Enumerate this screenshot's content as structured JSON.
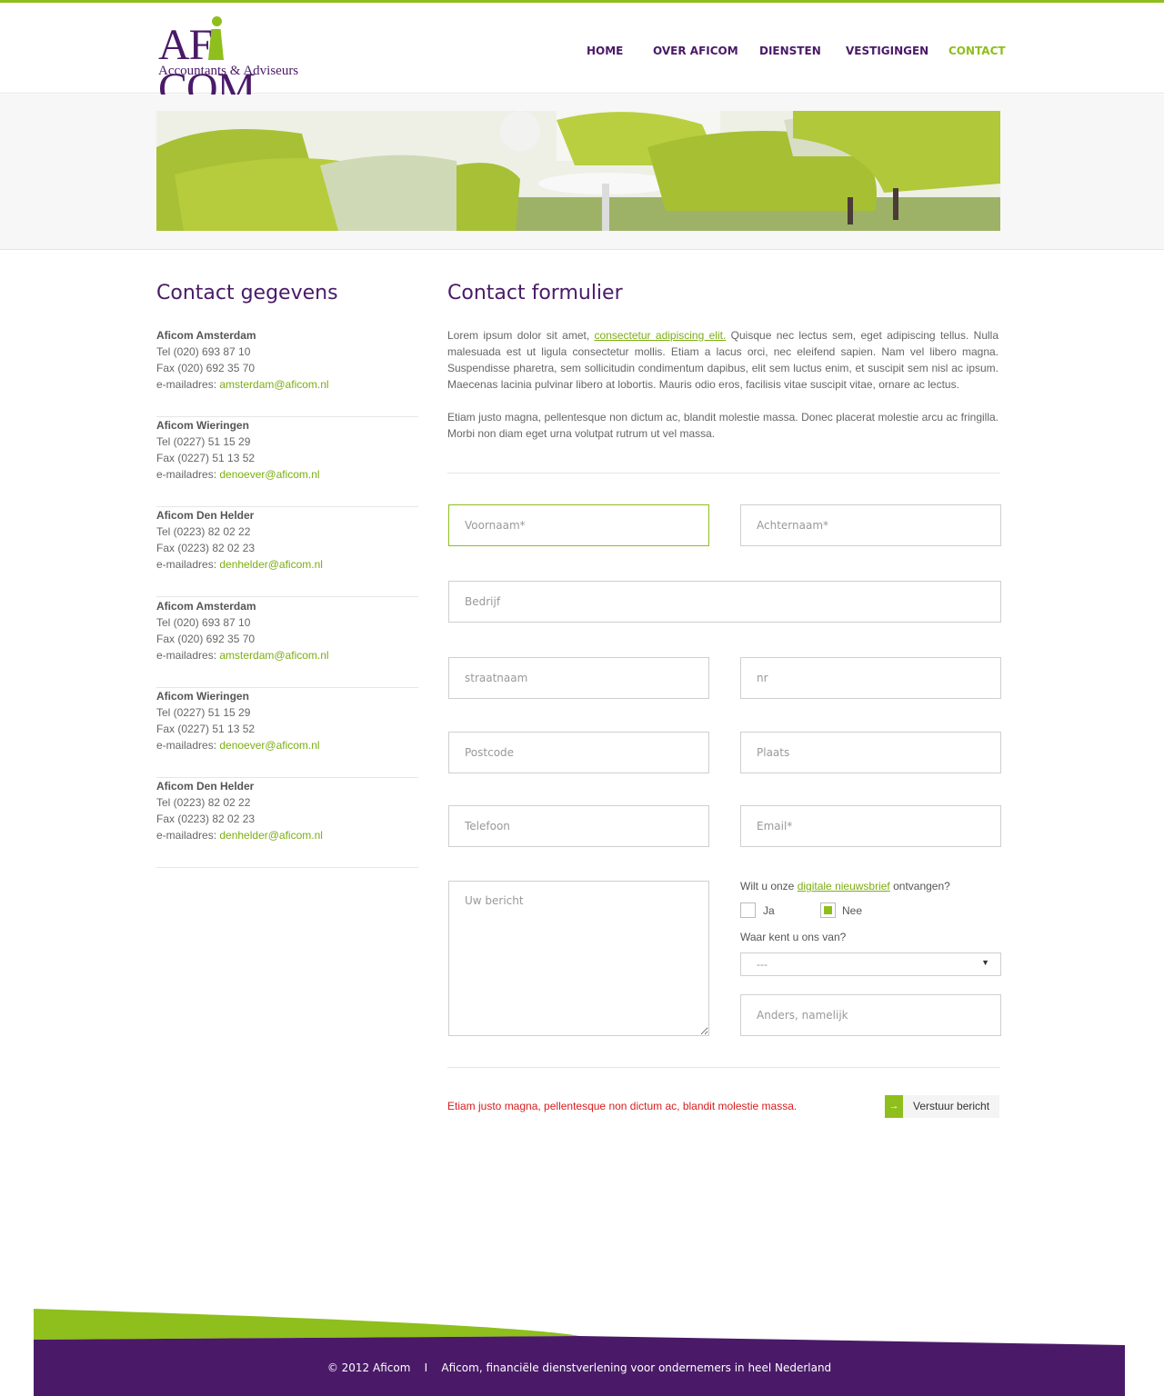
{
  "brand": {
    "logo_text": "AFICOM",
    "logo_tagline": "Accountants & Adviseurs",
    "primary_color": "#4a1a68",
    "accent_color": "#8ebf1c"
  },
  "nav": {
    "items": [
      "HOME",
      "OVER AFICOM",
      "DIENSTEN",
      "VESTIGINGEN",
      "CONTACT"
    ],
    "active": "CONTACT"
  },
  "sidebar": {
    "title": "Contact gegevens",
    "offices": [
      {
        "name": "Aficom Amsterdam",
        "tel": "Tel (020) 693 87 10",
        "fax": "Fax (020) 692 35 70",
        "email_label": "e-mailadres: ",
        "email": "amsterdam@aficom.nl"
      },
      {
        "name": "Aficom Wieringen",
        "tel": "Tel (0227) 51 15 29",
        "fax": "Fax (0227) 51 13 52",
        "email_label": "e-mailadres: ",
        "email": "denoever@aficom.nl"
      },
      {
        "name": "Aficom Den Helder",
        "tel": "Tel (0223) 82 02 22",
        "fax": "Fax (0223) 82 02 23",
        "email_label": "e-mailadres: ",
        "email": "denhelder@aficom.nl"
      },
      {
        "name": "Aficom Amsterdam",
        "tel": "Tel (020) 693 87 10",
        "fax": "Fax (020) 692 35 70",
        "email_label": "e-mailadres: ",
        "email": "amsterdam@aficom.nl"
      },
      {
        "name": "Aficom Wieringen",
        "tel": "Tel (0227) 51 15 29",
        "fax": "Fax (0227) 51 13 52",
        "email_label": "e-mailadres: ",
        "email": "denoever@aficom.nl"
      },
      {
        "name": "Aficom Den Helder",
        "tel": "Tel (0223) 82 02 22",
        "fax": "Fax (0223) 82 02 23",
        "email_label": "e-mailadres: ",
        "email": "denhelder@aficom.nl"
      }
    ]
  },
  "form": {
    "title": "Contact formulier",
    "intro_p1_before": "Lorem ipsum dolor sit amet, ",
    "intro_p1_link": "consectetur adipiscing elit.",
    "intro_p1_after": " Quisque nec lectus sem, eget adipiscing tellus. Nulla malesuada est ut ligula consectetur mollis. Etiam a lacus orci, nec eleifend sapien. Nam vel libero magna. Suspendisse pharetra, sem sollicitudin condimentum dapibus, elit sem luctus enim, et suscipit sem nisl ac ipsum. Maecenas lacinia pulvinar libero at lobortis. Mauris odio eros, facilisis vitae suscipit vitae, ornare ac lectus.",
    "intro_p2": "Etiam justo magna, pellentesque non dictum ac, blandit molestie massa. Donec placerat molestie arcu ac fringilla. Morbi non diam eget urna volutpat rutrum ut vel massa.",
    "placeholders": {
      "voornaam": "Voornaam*",
      "achternaam": "Achternaam*",
      "bedrijf": "Bedrijf",
      "straatnaam": "straatnaam",
      "nr": "nr",
      "postcode": "Postcode",
      "plaats": "Plaats",
      "telefoon": "Telefoon",
      "email": "Email*",
      "bericht": "Uw bericht",
      "anders": "Anders, namelijk"
    },
    "newsletter_before": "Wilt u onze ",
    "newsletter_link": "digitale nieuwsbrief",
    "newsletter_after": " ontvangen?",
    "option_yes": "Ja",
    "option_no": "Nee",
    "newsletter_selected": "Nee",
    "source_question": "Waar kent u ons van?",
    "source_selected": "---",
    "error_message": "Etiam justo magna, pellentesque non dictum ac, blandit molestie massa.",
    "submit_label": "Verstuur bericht",
    "submit_icon": "arrow-right-icon"
  },
  "footer": {
    "text": "© 2012 Aficom    I    Aficom, financiële dienstverlening voor ondernemers in heel Nederland"
  }
}
